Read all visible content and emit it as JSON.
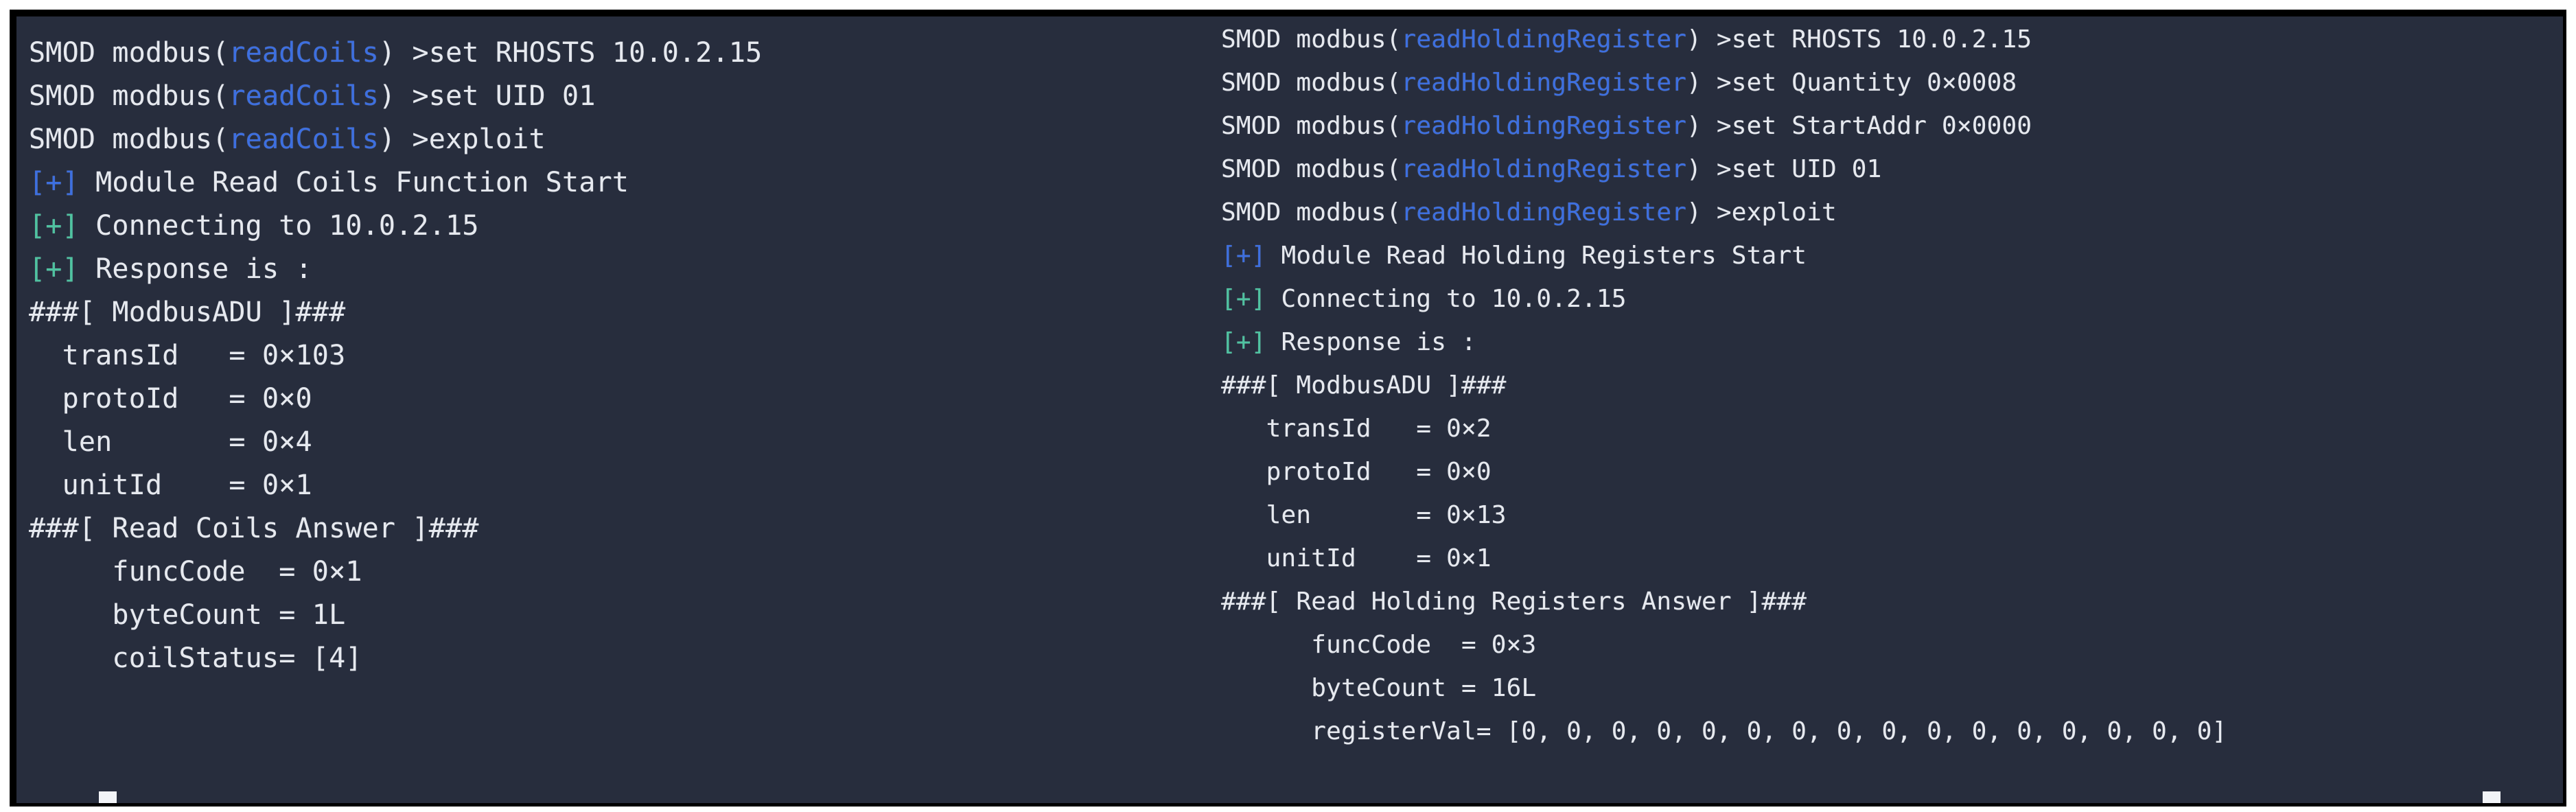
{
  "window": {
    "title": "SMOD Modbus Framework Terminal",
    "background_color": "#272d3d",
    "frame_color": "#000000",
    "text_color": "#e6e9ef",
    "module_color": "#3d6fe0",
    "status_ok_blue": "#3d6fe0",
    "status_ok_green": "#4fc3a1"
  },
  "left_pane": {
    "name": "read-coils-session",
    "prompt_module": "readCoils",
    "lines": [
      {
        "id": "l1",
        "type": "prompt",
        "prefix": "SMOD modbus(",
        "module": "readCoils",
        "suffix": ") >set RHOSTS 10.0.2.15"
      },
      {
        "id": "l2",
        "type": "prompt",
        "prefix": "SMOD modbus(",
        "module": "readCoils",
        "suffix": ") >set UID 01"
      },
      {
        "id": "l3",
        "type": "prompt",
        "prefix": "SMOD modbus(",
        "module": "readCoils",
        "suffix": ") >exploit"
      },
      {
        "id": "l4",
        "type": "status",
        "badge": "[+]",
        "badge_color": "blue",
        "text": " Module Read Coils Function Start"
      },
      {
        "id": "l5",
        "type": "status",
        "badge": "[+]",
        "badge_color": "green",
        "text": " Connecting to 10.0.2.15"
      },
      {
        "id": "l6",
        "type": "status",
        "badge": "[+]",
        "badge_color": "green",
        "text": " Response is :"
      },
      {
        "id": "l7",
        "type": "plain",
        "text": "###[ ModbusADU ]###"
      },
      {
        "id": "l8",
        "type": "plain",
        "text": "  transId   = 0×103"
      },
      {
        "id": "l9",
        "type": "plain",
        "text": "  protoId   = 0×0"
      },
      {
        "id": "l10",
        "type": "plain",
        "text": "  len       = 0×4"
      },
      {
        "id": "l11",
        "type": "plain",
        "text": "  unitId    = 0×1"
      },
      {
        "id": "l12",
        "type": "plain",
        "text": "###[ Read Coils Answer ]###"
      },
      {
        "id": "l13",
        "type": "plain",
        "text": "     funcCode  = 0×1"
      },
      {
        "id": "l14",
        "type": "plain",
        "text": "     byteCount = 1L"
      },
      {
        "id": "l15",
        "type": "plain",
        "text": "     coilStatus= [4]"
      }
    ]
  },
  "right_pane": {
    "name": "read-holding-register-session",
    "prompt_module": "readHoldingRegister",
    "lines": [
      {
        "id": "r1",
        "type": "prompt",
        "prefix": "SMOD modbus(",
        "module": "readHoldingRegister",
        "suffix": ") >set RHOSTS 10.0.2.15"
      },
      {
        "id": "r2",
        "type": "prompt",
        "prefix": "SMOD modbus(",
        "module": "readHoldingRegister",
        "suffix": ") >set Quantity 0×0008"
      },
      {
        "id": "r3",
        "type": "prompt",
        "prefix": "SMOD modbus(",
        "module": "readHoldingRegister",
        "suffix": ") >set StartAddr 0×0000"
      },
      {
        "id": "r4",
        "type": "prompt",
        "prefix": "SMOD modbus(",
        "module": "readHoldingRegister",
        "suffix": ") >set UID 01"
      },
      {
        "id": "r5",
        "type": "prompt",
        "prefix": "SMOD modbus(",
        "module": "readHoldingRegister",
        "suffix": ") >exploit"
      },
      {
        "id": "r6",
        "type": "status",
        "badge": "[+]",
        "badge_color": "blue",
        "text": " Module Read Holding Registers Start"
      },
      {
        "id": "r7",
        "type": "status",
        "badge": "[+]",
        "badge_color": "green",
        "text": " Connecting to 10.0.2.15"
      },
      {
        "id": "r8",
        "type": "status",
        "badge": "[+]",
        "badge_color": "green",
        "text": " Response is :"
      },
      {
        "id": "r9",
        "type": "plain",
        "text": "###[ ModbusADU ]###"
      },
      {
        "id": "r10",
        "type": "plain",
        "text": "   transId   = 0×2"
      },
      {
        "id": "r11",
        "type": "plain",
        "text": "   protoId   = 0×0"
      },
      {
        "id": "r12",
        "type": "plain",
        "text": "   len       = 0×13"
      },
      {
        "id": "r13",
        "type": "plain",
        "text": "   unitId    = 0×1"
      },
      {
        "id": "r14",
        "type": "plain",
        "text": "###[ Read Holding Registers Answer ]###"
      },
      {
        "id": "r15",
        "type": "plain",
        "text": "      funcCode  = 0×3"
      },
      {
        "id": "r16",
        "type": "plain",
        "text": "      byteCount = 16L"
      },
      {
        "id": "r17",
        "type": "plain",
        "text": "      registerVal= [0, 0, 0, 0, 0, 0, 0, 0, 0, 0, 0, 0, 0, 0, 0, 0]"
      }
    ]
  },
  "cursors": {
    "left_cursor": "block",
    "right_cursor": "block"
  }
}
